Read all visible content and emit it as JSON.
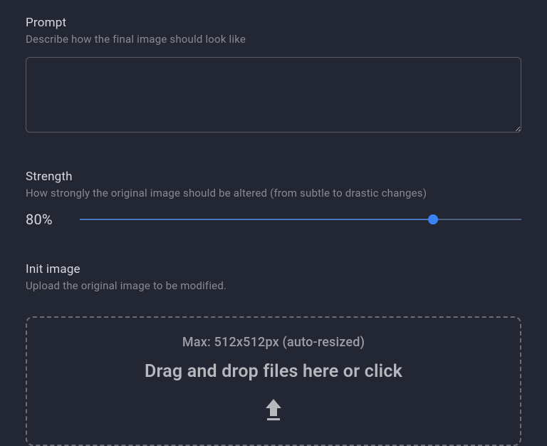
{
  "prompt": {
    "label": "Prompt",
    "help": "Describe how the final image should look like",
    "value": ""
  },
  "strength": {
    "label": "Strength",
    "help": "How strongly the original image should be altered (from subtle to drastic changes)",
    "value_text": "80%",
    "percent": 80
  },
  "init_image": {
    "label": "Init image",
    "help": "Upload the original image to be modified.",
    "max_text": "Max: 512x512px (auto-resized)",
    "dropzone_text": "Drag and drop files here or click"
  }
}
